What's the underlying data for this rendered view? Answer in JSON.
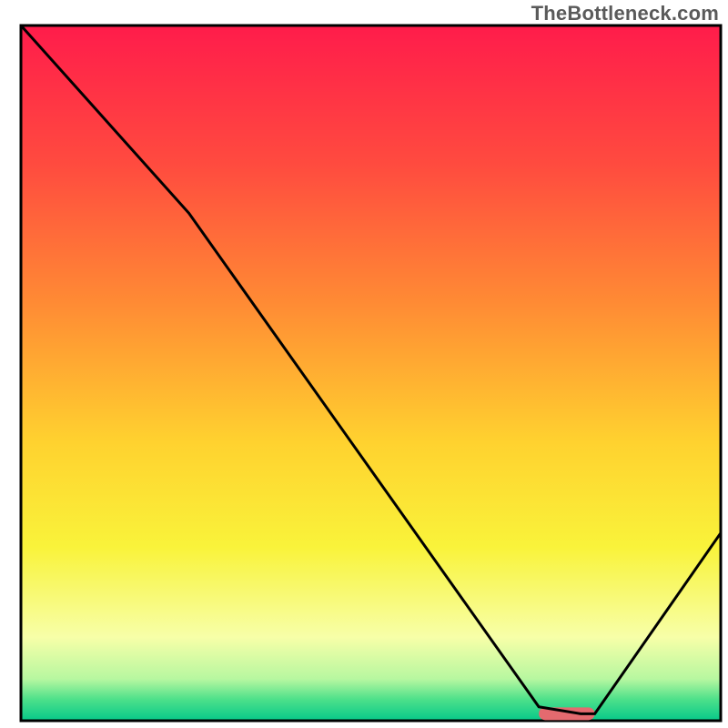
{
  "watermark": "TheBottleneck.com",
  "chart_data": {
    "type": "line",
    "title": "",
    "xlabel": "",
    "ylabel": "",
    "xlim": [
      0,
      100
    ],
    "ylim": [
      0,
      100
    ],
    "grid": false,
    "legend": false,
    "series": [
      {
        "name": "bottleneck-curve",
        "color": "#000000",
        "x": [
          0,
          24,
          74,
          80,
          82,
          100
        ],
        "values": [
          100,
          73,
          2,
          1,
          1,
          27
        ]
      }
    ],
    "markers": [
      {
        "name": "optimal-range",
        "shape": "rounded-bar",
        "color": "#e46a6f",
        "x_start": 74,
        "x_end": 82,
        "y": 1
      }
    ],
    "background_gradient": {
      "type": "vertical",
      "stops": [
        {
          "offset": 0.0,
          "color": "#ff1c4b"
        },
        {
          "offset": 0.2,
          "color": "#ff4b3f"
        },
        {
          "offset": 0.4,
          "color": "#ff8b34"
        },
        {
          "offset": 0.6,
          "color": "#ffd22f"
        },
        {
          "offset": 0.75,
          "color": "#f9f33a"
        },
        {
          "offset": 0.88,
          "color": "#f7ffa8"
        },
        {
          "offset": 0.94,
          "color": "#b7f7a0"
        },
        {
          "offset": 0.97,
          "color": "#4be08a"
        },
        {
          "offset": 1.0,
          "color": "#06c889"
        }
      ]
    }
  }
}
